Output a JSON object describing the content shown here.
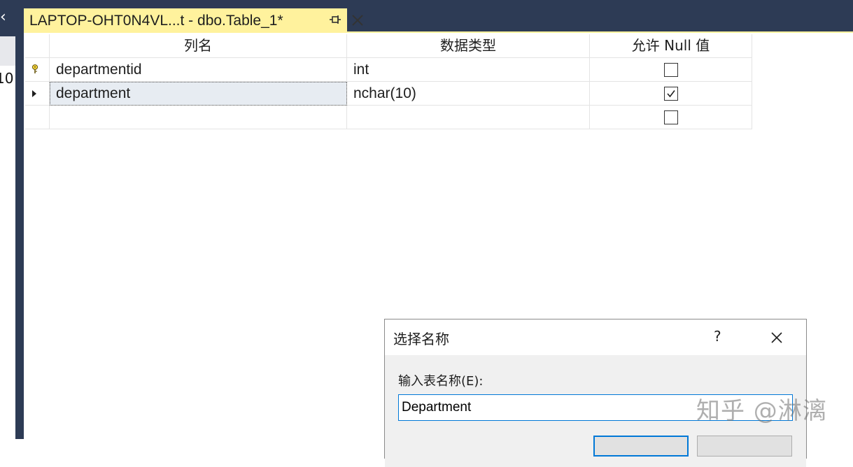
{
  "document_tab": {
    "title": "LAPTOP-OHT0N4VL...t - dbo.Table_1*",
    "pin_icon": "pin-icon",
    "close_icon": "close-icon"
  },
  "left_panel": {
    "partial_text": "10",
    "chevron": "‹"
  },
  "grid": {
    "columns": [
      "列名",
      "数据类型",
      "允许 Null 值"
    ],
    "rows": [
      {
        "indicator": "primary-key-icon",
        "name": "departmentid",
        "type": "int",
        "allow_null": false
      },
      {
        "indicator": "row-pointer-icon",
        "name": "department",
        "type": "nchar(10)",
        "allow_null": true
      },
      {
        "indicator": "",
        "name": "",
        "type": "",
        "allow_null": false
      }
    ]
  },
  "dialog": {
    "title": "选择名称",
    "help": "?",
    "label": "输入表名称(E):",
    "input_value": "Department"
  },
  "watermark": {
    "text": "知乎 @淋漓"
  },
  "colors": {
    "chrome": "#2d3b55",
    "tab_active": "#fff29d",
    "input_border": "#0078d7"
  }
}
